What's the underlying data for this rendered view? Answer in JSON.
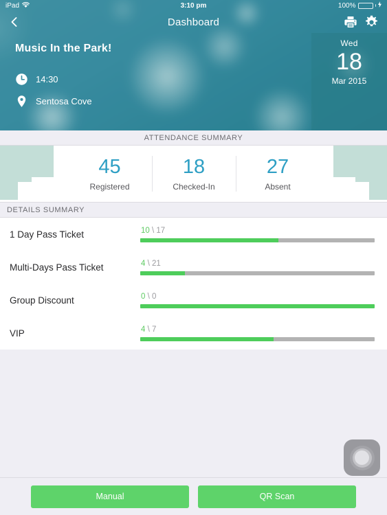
{
  "status_bar": {
    "device": "iPad",
    "wifi_icon": "wifi-icon",
    "time": "3:10 pm",
    "battery_percent": "100%",
    "battery_icon": "battery-charging-icon"
  },
  "nav": {
    "back_icon": "back-chevron-icon",
    "title": "Dashboard",
    "print_icon": "printer-icon",
    "settings_icon": "gear-icon"
  },
  "event": {
    "title": "Music In the Park!",
    "time": "14:30",
    "time_icon": "clock-icon",
    "location": "Sentosa Cove",
    "location_icon": "map-pin-icon",
    "date": {
      "day_of_week": "Wed",
      "day": "18",
      "month_year": "Mar 2015"
    }
  },
  "attendance": {
    "header": "ATTENDANCE SUMMARY",
    "stats": [
      {
        "value": "45",
        "label": "Registered"
      },
      {
        "value": "18",
        "label": "Checked-In"
      },
      {
        "value": "27",
        "label": "Absent"
      }
    ]
  },
  "details": {
    "header": "DETAILS SUMMARY",
    "rows": [
      {
        "label": "1 Day Pass Ticket",
        "checked_in": "10",
        "separator": " \\ ",
        "total": "17",
        "percent": 59
      },
      {
        "label": "Multi-Days Pass Ticket",
        "checked_in": "4",
        "separator": " \\ ",
        "total": "21",
        "percent": 19
      },
      {
        "label": "Group Discount",
        "checked_in": "0",
        "separator": " \\ ",
        "total": "0",
        "percent": 100
      },
      {
        "label": "VIP",
        "checked_in": "4",
        "separator": " \\ ",
        "total": "7",
        "percent": 57
      }
    ]
  },
  "footer": {
    "manual_label": "Manual",
    "qr_label": "QR Scan"
  },
  "assistive_touch": {
    "icon": "assistive-touch-icon"
  },
  "colors": {
    "accent_teal": "#2e9fc4",
    "green": "#4ecd5b",
    "hero_teal": "#3d8fa4",
    "step_block": "#c3ded7",
    "page_bg": "#efeef4"
  }
}
